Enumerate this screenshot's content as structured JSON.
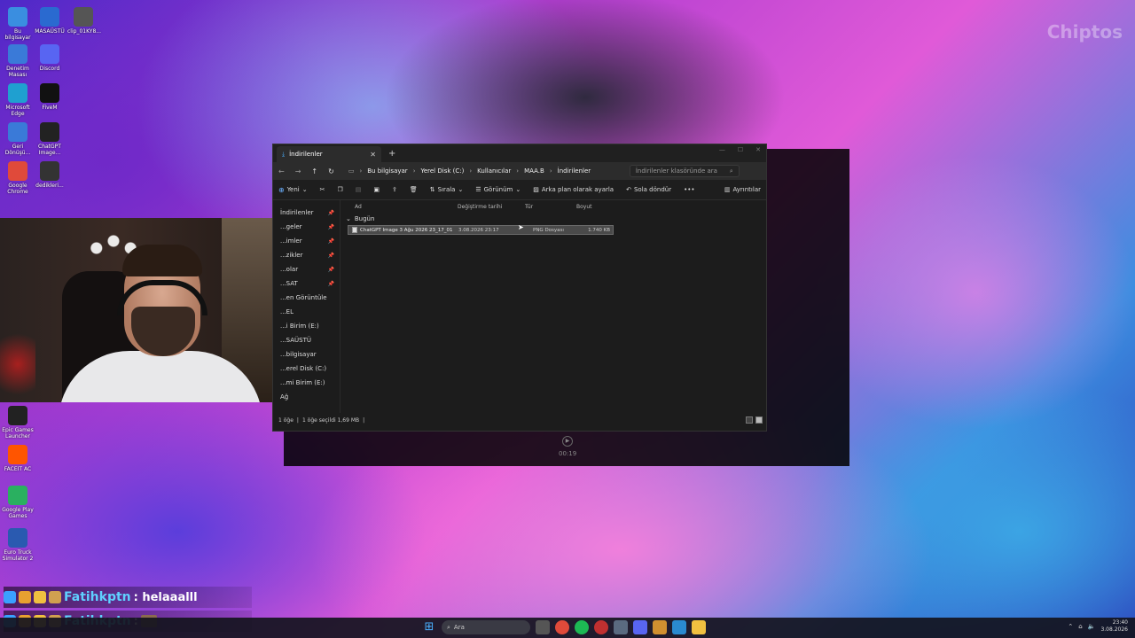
{
  "watermark": "Chiptos",
  "desktop_icons": [
    {
      "label": "Bu bilgisayar",
      "color": "#3a8ee0"
    },
    {
      "label": "MASAÜSTÜ",
      "color": "#2a6ad0"
    },
    {
      "label": "clip_01KY8...",
      "color": "#555555"
    },
    {
      "label": "Denetim Masası",
      "color": "#3a7ad8"
    },
    {
      "label": "Discord",
      "color": "#5865f2"
    },
    {
      "label": "Microsoft Edge",
      "color": "#1fa0d0"
    },
    {
      "label": "FiveM",
      "color": "#111111"
    },
    {
      "label": "Geri Dönüşü...",
      "color": "#3a7ad8"
    },
    {
      "label": "ChatGPT Image...",
      "color": "#222222"
    },
    {
      "label": "Google Chrome",
      "color": "#e04a3a"
    },
    {
      "label": "dedikleri...",
      "color": "#333333"
    },
    {
      "label": "Epic Games Launcher",
      "color": "#222222"
    },
    {
      "label": "FACEIT AC",
      "color": "#ff5500"
    },
    {
      "label": "Google Play Games",
      "color": "#2ab060"
    },
    {
      "label": "Euro Truck Simulator 2",
      "color": "#2a5ab0"
    }
  ],
  "explorer": {
    "tab_title": "İndirilenler",
    "breadcrumb": [
      "Bu bilgisayar",
      "Yerel Disk (C:)",
      "Kullanıcılar",
      "MAA.B",
      "İndirilenler"
    ],
    "search_placeholder": "İndirilenler klasöründe ara",
    "toolbar": {
      "new_label": "Yeni",
      "sort_label": "Sırala",
      "view_label": "Görünüm",
      "set_bg_label": "Arka plan olarak ayarla",
      "rotate_label": "Sola döndür",
      "details_label": "Ayrıntılar"
    },
    "nav_items": [
      "İndirilenler",
      "...geler",
      "...imler",
      "...zikler",
      "...olar",
      "...SAT",
      "...en Görüntüle",
      "...EL",
      "...i Birim (E:)",
      "...SAÜSTÜ",
      "...bilgisayar",
      "...erel Disk (C:)",
      "...mi Birim (E:)",
      "Ağ"
    ],
    "columns": {
      "name": "Ad",
      "date": "Değiştirme tarihi",
      "type": "Tür",
      "size": "Boyut"
    },
    "group": "Bugün",
    "files": [
      {
        "name": "ChatGPT Image 3 Ağu 2026 23_17_01",
        "date": "3.08.2026 23:17",
        "type": "PNG Dosyası",
        "size": "1.740 KB"
      }
    ],
    "status": {
      "count": "1 öğe",
      "selected": "1 öğe seçildi  1,69 MB"
    }
  },
  "player": {
    "time": "00:19"
  },
  "chat": [
    {
      "user": "Fatihkptn",
      "message": ": helaaalll"
    },
    {
      "user": "Fatihkptn",
      "message": ":"
    }
  ],
  "taskbar": {
    "search_label": "Ara",
    "time": "23:40",
    "date": "3.08.2026"
  }
}
